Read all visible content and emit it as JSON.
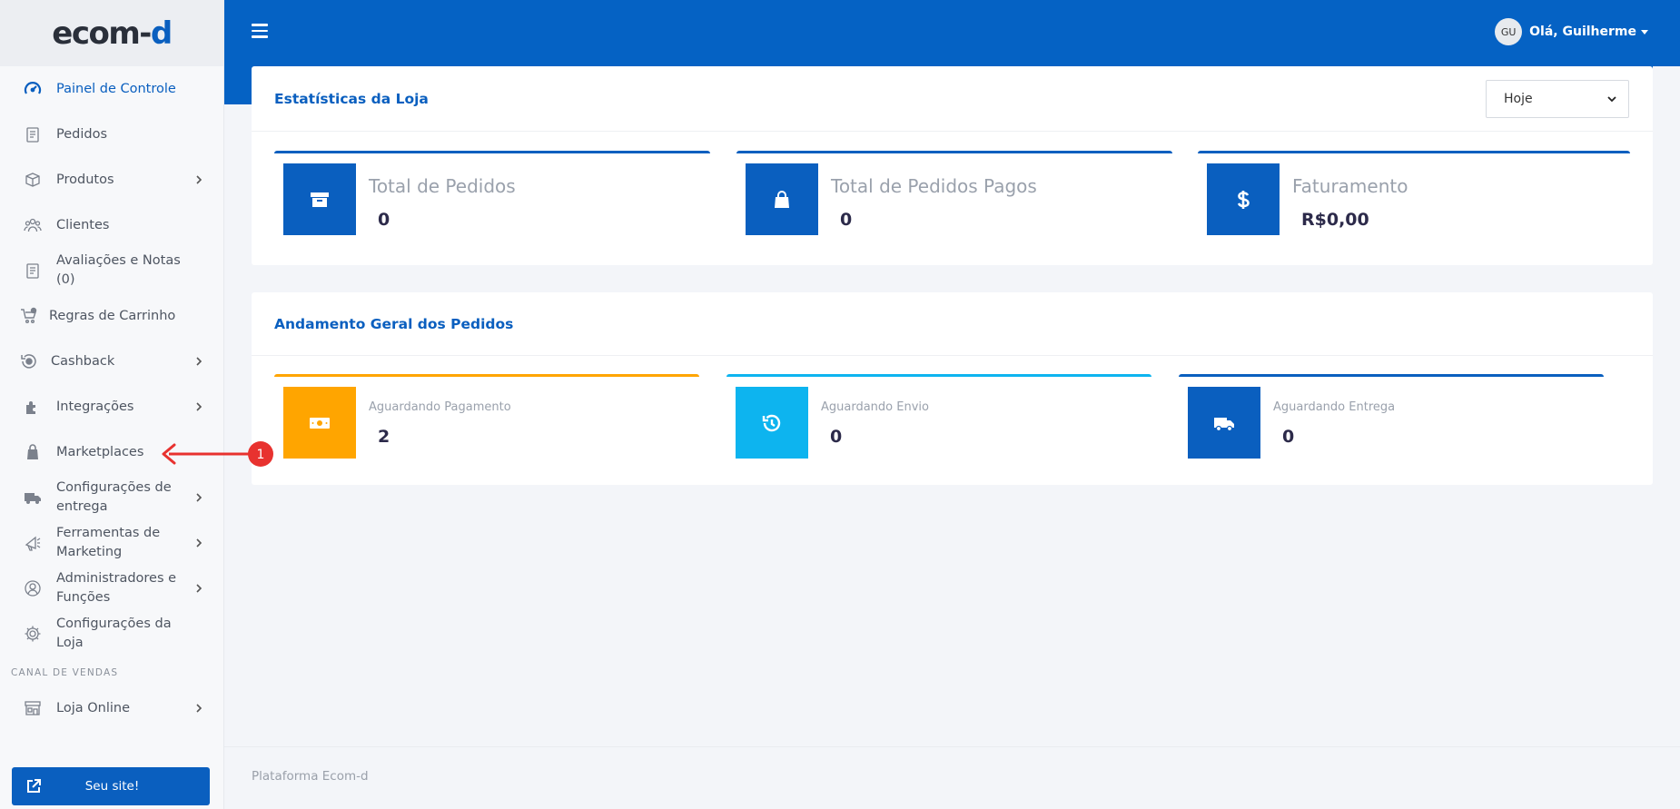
{
  "brand": {
    "logo_main": "ecom-",
    "logo_accent": "d"
  },
  "topbar": {
    "avatar_initials": "GU",
    "greeting": "Olá, Guilherme"
  },
  "sidebar": {
    "items": [
      {
        "label": "Painel de Controle",
        "icon": "speedometer-icon",
        "active": true
      },
      {
        "label": "Pedidos",
        "icon": "orders-icon"
      },
      {
        "label": "Produtos",
        "icon": "products-icon",
        "expandable": true
      },
      {
        "label": "Clientes",
        "icon": "users-icon"
      },
      {
        "label": "Avaliações e Notas (0)",
        "icon": "reviews-icon"
      },
      {
        "label": "Regras de Carrinho",
        "icon": "cart-rules-icon"
      },
      {
        "label": "Cashback",
        "icon": "cashback-icon",
        "expandable": true
      },
      {
        "label": "Integrações",
        "icon": "puzzle-icon",
        "expandable": true
      },
      {
        "label": "Marketplaces",
        "icon": "bag-icon"
      },
      {
        "label": "Configurações de entrega",
        "icon": "truck-icon",
        "expandable": true
      },
      {
        "label": "Ferramentas de Marketing",
        "icon": "megaphone-icon",
        "expandable": true
      },
      {
        "label": "Administradores e Funções",
        "icon": "admin-icon",
        "expandable": true
      },
      {
        "label": "Configurações da Loja",
        "icon": "gear-icon"
      }
    ],
    "section_label": "CANAL DE VENDAS",
    "sales_items": [
      {
        "label": "Loja Online",
        "icon": "store-icon",
        "expandable": true
      }
    ],
    "site_button": "Seu site!"
  },
  "store_stats": {
    "title": "Estatísticas da Loja",
    "period": "Hoje",
    "cards": [
      {
        "title": "Total de Pedidos",
        "value": "0",
        "icon": "archive-icon",
        "color": "#0a5fbf"
      },
      {
        "title": "Total de Pedidos Pagos",
        "value": "0",
        "icon": "bag-icon",
        "color": "#0a5fbf"
      },
      {
        "title": "Faturamento",
        "value": "R$0,00",
        "icon": "dollar-icon",
        "color": "#0a5fbf"
      }
    ]
  },
  "orders_progress": {
    "title": "Andamento Geral dos Pedidos",
    "cards": [
      {
        "title": "Aguardando Pagamento",
        "value": "2",
        "icon": "money-icon",
        "color": "#ffa500"
      },
      {
        "title": "Aguardando Envio",
        "value": "0",
        "icon": "history-icon",
        "color": "#0db4ef"
      },
      {
        "title": "Aguardando Entrega",
        "value": "0",
        "icon": "truck-icon",
        "color": "#0a5fbf"
      }
    ]
  },
  "annotation": {
    "number": "1",
    "color": "#e8322f"
  },
  "footer": {
    "text": "Plataforma Ecom-d"
  }
}
